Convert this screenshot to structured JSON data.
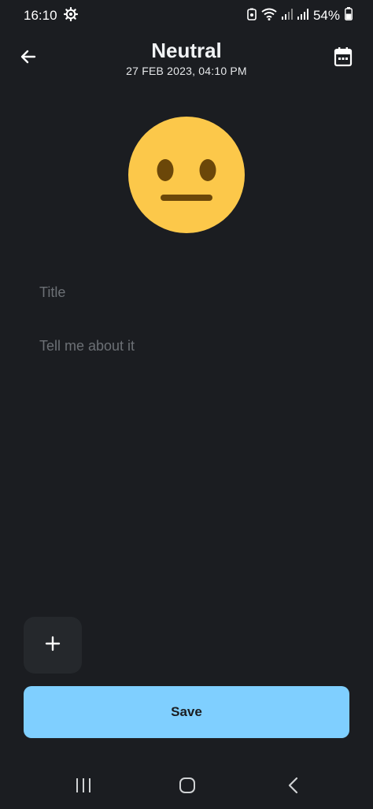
{
  "status_bar": {
    "time": "16:10",
    "battery": "54%",
    "icons": [
      "settings-gear-icon",
      "alarm-icon",
      "wifi-icon",
      "signal-icon",
      "signal-icon",
      "battery-icon"
    ]
  },
  "header": {
    "title": "Neutral",
    "date": "27 FEB 2023, 04:10 PM",
    "back_icon": "arrow-left-icon",
    "calendar_icon": "calendar-icon"
  },
  "mood": {
    "emoji": "neutral-face-icon",
    "color": "#fcc84a"
  },
  "form": {
    "title_placeholder": "Title",
    "title_value": "",
    "body_placeholder": "Tell me about it",
    "body_value": ""
  },
  "actions": {
    "add_icon": "plus-icon",
    "save_label": "Save",
    "save_color": "#7fcfff"
  },
  "nav": {
    "items": [
      "recents-icon",
      "home-icon",
      "back-icon"
    ]
  }
}
